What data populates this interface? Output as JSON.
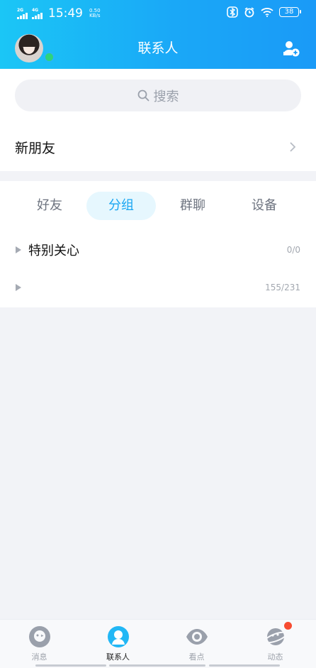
{
  "status_bar": {
    "network_1": "2G",
    "network_2": "4G",
    "time": "15:49",
    "speed_value": "0.50",
    "speed_unit": "KB/s",
    "battery": "38"
  },
  "header": {
    "title": "联系人"
  },
  "search": {
    "placeholder": "搜索"
  },
  "new_friends": {
    "label": "新朋友"
  },
  "tabs": [
    {
      "label": "好友",
      "active": false
    },
    {
      "label": "分组",
      "active": true
    },
    {
      "label": "群聊",
      "active": false
    },
    {
      "label": "设备",
      "active": false
    }
  ],
  "groups": [
    {
      "name": "特别关心",
      "count": "0/0"
    },
    {
      "name": "",
      "count": "155/231"
    }
  ],
  "bottom_nav": [
    {
      "label": "消息",
      "icon": "message-icon",
      "active": false
    },
    {
      "label": "联系人",
      "icon": "contacts-icon",
      "active": true
    },
    {
      "label": "看点",
      "icon": "eye-icon",
      "active": false
    },
    {
      "label": "动态",
      "icon": "planet-icon",
      "active": false,
      "badge": true
    }
  ],
  "colors": {
    "accent": "#1aa6f2",
    "header_start": "#1bc6f6",
    "header_end": "#1a9af7",
    "online": "#2ed37c",
    "badge": "#f74c31"
  }
}
